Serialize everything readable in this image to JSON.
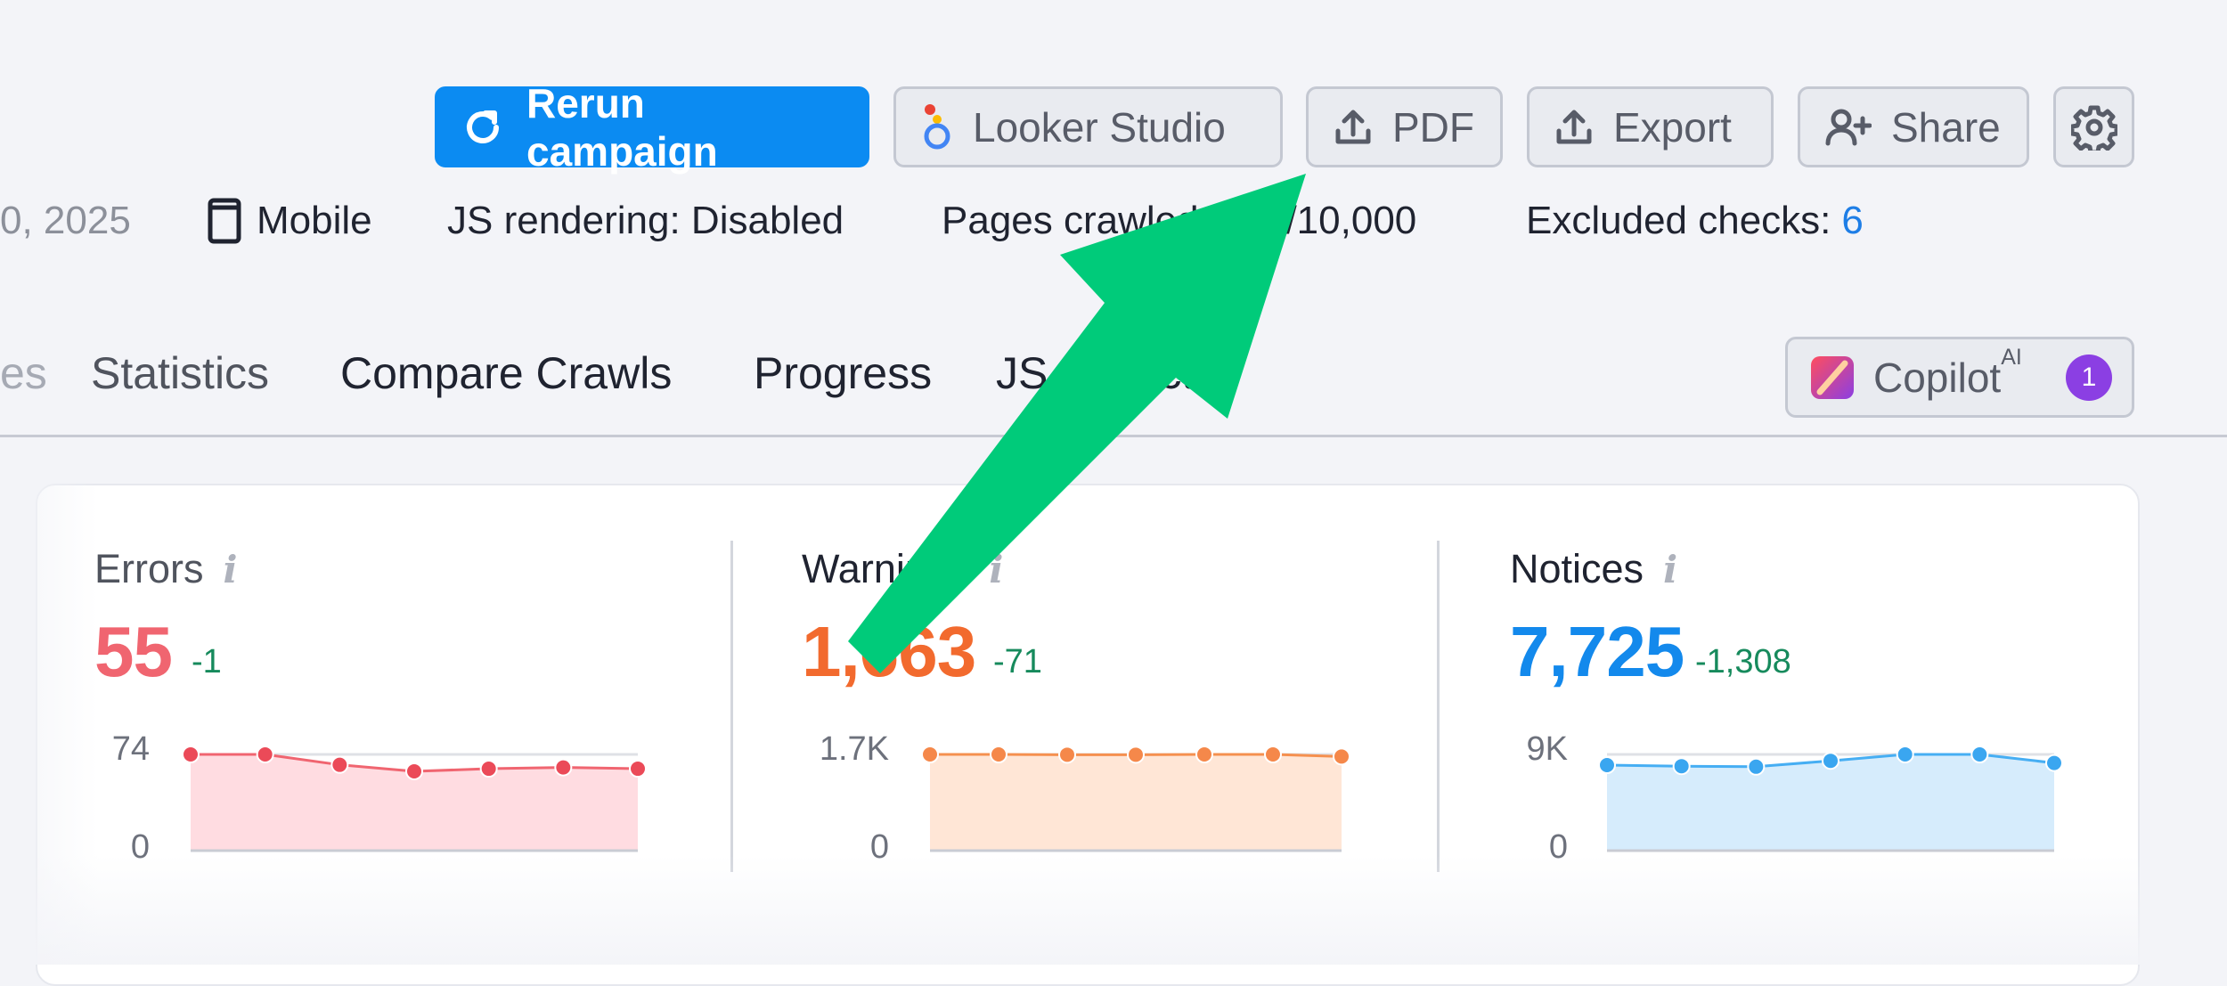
{
  "colors": {
    "primary": "#0b8bf2",
    "errors": "#f06570",
    "warnings": "#f26a2e",
    "notices": "#1389ec",
    "delta": "#168a5c",
    "arrow": "#00cb7a",
    "copilot_badge": "#8b3fe3"
  },
  "toolbar": {
    "rerun_label": "Rerun campaign",
    "looker_label": "Looker Studio",
    "pdf_label": "PDF",
    "export_label": "Export",
    "share_label": "Share",
    "settings_icon": "gear-icon"
  },
  "info_bar": {
    "date_fragment": "0, 2025",
    "device": "Mobile",
    "js_rendering": "JS rendering: Disabled",
    "pages_crawled": "Pages crawled: 406/10,000",
    "excluded_checks_label": "Excluded checks:",
    "excluded_checks_value": "6"
  },
  "tabs": [
    {
      "label": "es"
    },
    {
      "label": "Statistics"
    },
    {
      "label": "Compare Crawls"
    },
    {
      "label": "Progress"
    },
    {
      "label": "JS Impact"
    }
  ],
  "copilot": {
    "label": "Copilot",
    "sup": "AI",
    "badge": "1"
  },
  "metrics": [
    {
      "title": "Errors",
      "value": "55",
      "delta": "-1",
      "ymax_label": "74",
      "ymin_label": "0",
      "ymax": 74,
      "points": [
        74,
        74,
        66,
        61,
        63,
        64,
        63
      ]
    },
    {
      "title": "Warnings",
      "value": "1,663",
      "delta": "-71",
      "ymax_label": "1.7K",
      "ymin_label": "0",
      "ymax": 1700,
      "points": [
        1700,
        1700,
        1695,
        1695,
        1700,
        1700,
        1663
      ]
    },
    {
      "title": "Notices",
      "value": "7,725",
      "delta": "-1,308",
      "ymax_label": "9K",
      "ymin_label": "0",
      "ymax": 9000,
      "points": [
        8000,
        7900,
        7850,
        8400,
        9000,
        9000,
        8200
      ]
    }
  ]
}
